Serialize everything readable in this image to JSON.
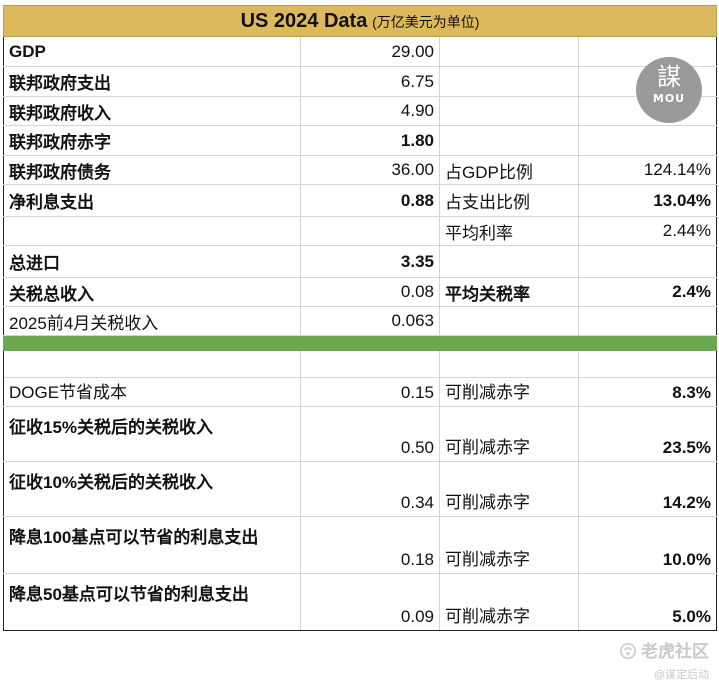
{
  "header": {
    "title": "US 2024 Data",
    "subtitle": "(万亿美元为单位)"
  },
  "rows": {
    "gdp": {
      "label": "GDP",
      "value": "29.00"
    },
    "spend": {
      "label": "联邦政府支出",
      "value": "6.75"
    },
    "revenue": {
      "label": "联邦政府收入",
      "value": "4.90"
    },
    "deficit": {
      "label": "联邦政府赤字",
      "value": "1.80"
    },
    "debt": {
      "label": "联邦政府债务",
      "value": "36.00",
      "metric_label": "占GDP比例",
      "metric_value": "124.14%"
    },
    "interest": {
      "label": "净利息支出",
      "value": "0.88",
      "metric_label": "占支出比例",
      "metric_value": "13.04%"
    },
    "avg_rate": {
      "metric_label": "平均利率",
      "metric_value": "2.44%"
    },
    "imports": {
      "label": "总进口",
      "value": "3.35"
    },
    "tariff": {
      "label": "关税总收入",
      "value": "0.08",
      "metric_label": "平均关税率",
      "metric_value": "2.4%"
    },
    "tariff_2025": {
      "label": "2025前4月关税收入",
      "value": "0.063"
    }
  },
  "scenarios": [
    {
      "label": "DOGE节省成本",
      "value": "0.15",
      "metric_label": "可削减赤字",
      "metric_value": "8.3%"
    },
    {
      "label": "征收15%关税后的关税收入",
      "value": "0.50",
      "metric_label": "可削减赤字",
      "metric_value": "23.5%"
    },
    {
      "label": "征收10%关税后的关税收入",
      "value": "0.34",
      "metric_label": "可削减赤字",
      "metric_value": "14.2%"
    },
    {
      "label": "降息100基点可以节省的利息支出",
      "value": "0.18",
      "metric_label": "可削减赤字",
      "metric_value": "10.0%"
    },
    {
      "label": "降息50基点可以节省的利息支出",
      "value": "0.09",
      "metric_label": "可削减赤字",
      "metric_value": "5.0%"
    }
  ],
  "logo": {
    "char": "謀",
    "text": "MOU"
  },
  "watermark": {
    "brand": "老虎社区",
    "user": "@谋定后动"
  },
  "colors": {
    "header_bg": "#dcb95c",
    "divider": "#6aa84f",
    "highlight": "#e0201e"
  }
}
